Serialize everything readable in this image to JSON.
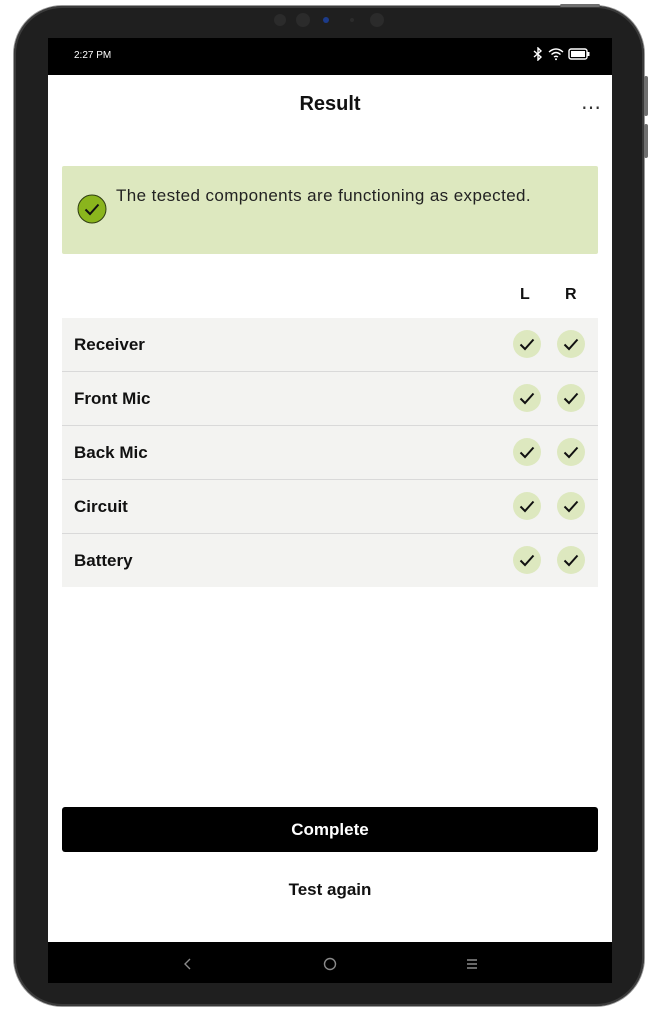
{
  "status_bar": {
    "time": "2:27 PM",
    "icons": [
      "bluetooth-icon",
      "wifi-icon",
      "battery-icon"
    ]
  },
  "header": {
    "title": "Result",
    "menu_icon": "more-horizontal-icon"
  },
  "banner": {
    "icon": "check-circle-icon",
    "message": "The tested components are functioning as expected.",
    "background": "#dde8bf",
    "icon_color": "#8ab51d"
  },
  "table": {
    "columns": [
      "L",
      "R"
    ],
    "rows": [
      {
        "label": "Receiver",
        "left": "pass",
        "right": "pass"
      },
      {
        "label": "Front Mic",
        "left": "pass",
        "right": "pass"
      },
      {
        "label": "Back Mic",
        "left": "pass",
        "right": "pass"
      },
      {
        "label": "Circuit",
        "left": "pass",
        "right": "pass"
      },
      {
        "label": "Battery",
        "left": "pass",
        "right": "pass"
      }
    ],
    "check_background": "#dde8bf"
  },
  "actions": {
    "complete_label": "Complete",
    "test_again_label": "Test again"
  },
  "nav_bar": {
    "icons": [
      "back-icon",
      "home-icon",
      "recents-icon"
    ]
  }
}
